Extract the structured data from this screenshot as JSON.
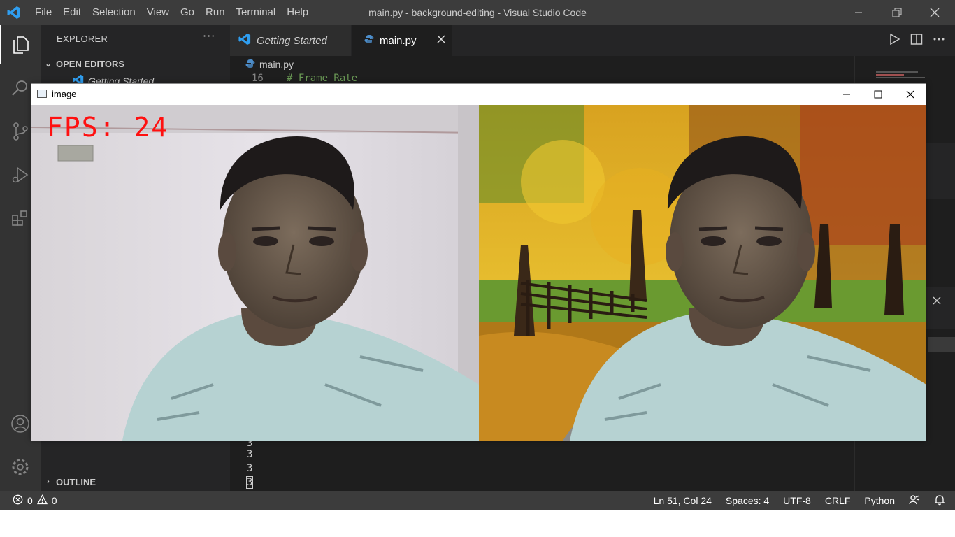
{
  "titlebar": {
    "menu": [
      "File",
      "Edit",
      "Selection",
      "View",
      "Go",
      "Run",
      "Terminal",
      "Help"
    ],
    "title": "main.py - background-editing - Visual Studio Code"
  },
  "activitybar": {
    "icons": [
      "explorer-icon",
      "search-icon",
      "source-control-icon",
      "run-debug-icon",
      "extensions-icon",
      "account-icon",
      "settings-gear-icon"
    ]
  },
  "sidebar": {
    "title": "EXPLORER",
    "more": "···",
    "open_editors": "OPEN EDITORS",
    "open_editor_item": "Getting Started",
    "outline": "OUTLINE"
  },
  "tabs": [
    {
      "label": "Getting Started",
      "active": false
    },
    {
      "label": "main.py",
      "active": true
    }
  ],
  "breadcrumb": {
    "file": "main.py"
  },
  "editor": {
    "line_number": "16",
    "line_text": "# Frame Rate"
  },
  "terminal": {
    "lines": [
      "3",
      "3",
      "3",
      "3"
    ]
  },
  "cv_window": {
    "title": "image",
    "fps_label": "FPS: 24",
    "left_frame": "webcam-original",
    "right_frame": "background-replaced"
  },
  "statusbar": {
    "errors": "0",
    "warnings": "0",
    "position": "Ln 51, Col 24",
    "spaces": "Spaces: 4",
    "encoding": "UTF-8",
    "eol": "CRLF",
    "language": "Python"
  },
  "colors": {
    "titlebar": "#3c3c3c",
    "activitybar": "#333333",
    "sidebar": "#252526",
    "editor": "#1e1e1e",
    "statusbar": "#3c3c3c",
    "fps_text": "#ff1010"
  }
}
